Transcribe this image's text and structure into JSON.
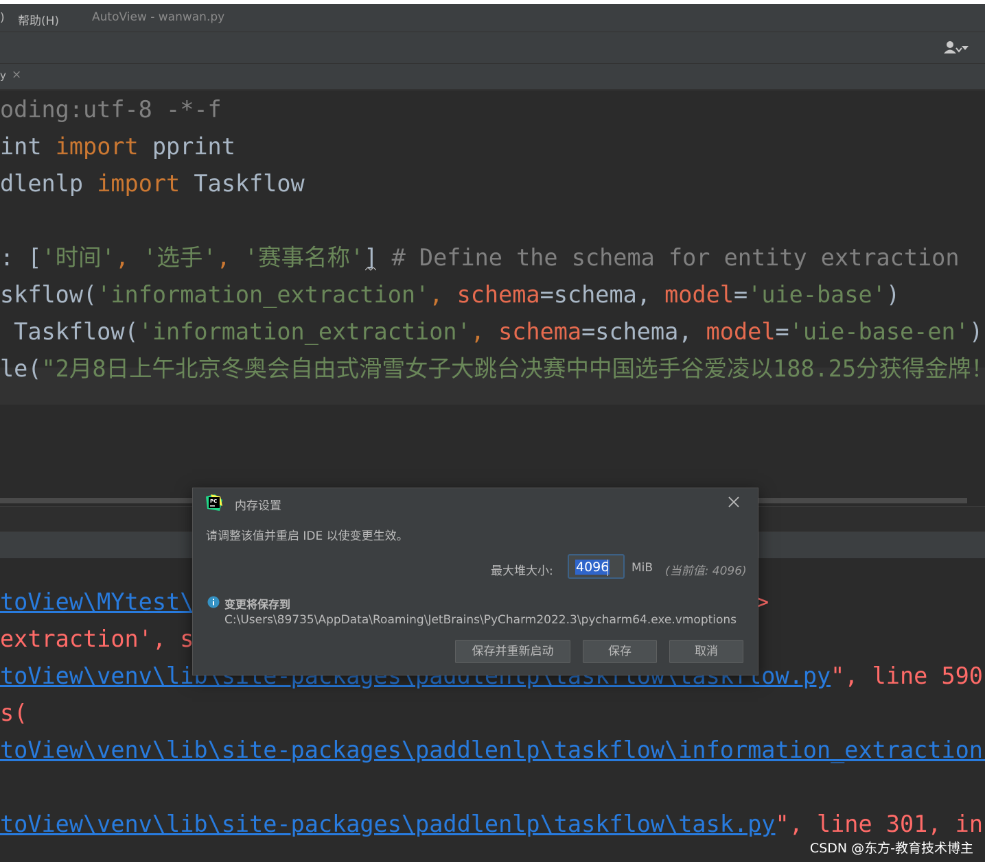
{
  "menubar": {
    "menu_fragment": ")",
    "help_menu": "帮助(H)",
    "window_title": "AutoView - wanwan.py"
  },
  "tab": {
    "label": "y",
    "close": "×"
  },
  "editor": {
    "lines": [
      {
        "text": "oding:utf-8 -*-f"
      },
      {
        "a": "int ",
        "kw": "import",
        "b": " pprint"
      },
      {
        "a": "dlenlp ",
        "kw": "import",
        "b": " Taskflow"
      },
      {
        "c": ": [",
        "s1": "'时间'",
        "c2": ", ",
        "s2": "'选手'",
        "c3": ", ",
        "s3": "'赛事名称'",
        "c4": "] ",
        "cm": "# Define the schema for entity extraction"
      },
      {
        "a": "skflow(",
        "s": "'information_extraction'",
        "b": ", ",
        "p1": "schema",
        "c": "=schema, ",
        "p2": "model",
        "d": "=",
        "s2": "'uie-base'",
        "e": ")"
      },
      {
        "a": " Taskflow(",
        "s": "'information_extraction'",
        "b": ", ",
        "p1": "schema",
        "c": "=schema, ",
        "p2": "model",
        "d": "=",
        "s2": "'uie-base-en'",
        "e": ")"
      },
      {
        "a": "le(",
        "s": "\"2月8日上午北京冬奥会自由式滑雪女子大跳台决赛中中国选手谷爱凌以188.25分获得金牌！\""
      }
    ]
  },
  "console": {
    "lines": [
      {
        "link": "toView\\MYtest\\",
        "err": ">"
      },
      {
        "err": "extraction', s"
      },
      {
        "link": "toView\\venv\\lib\\site-packages\\paddlenlp\\taskflow\\taskflow.py",
        "err": "\", line 590,"
      },
      {
        "err": "s("
      },
      {
        "link": "toView\\venv\\lib\\site-packages\\paddlenlp\\taskflow\\information_extraction.",
        "err": ""
      },
      {
        "link": "toView\\venv\\lib\\site-packages\\paddlenlp\\taskflow\\task.py",
        "err": "\", line 301, in"
      }
    ]
  },
  "watermark": "CSDN @东方-教育技术博主",
  "dialog": {
    "title": "内存设置",
    "description": "请调整该值并重启 IDE 以使变更生效。",
    "heap_label": "最大堆大小:",
    "heap_value": "4096",
    "heap_unit": "MiB",
    "current_value": "(当前值: 4096)",
    "save_to_title": "变更将保存到",
    "save_path": "C:\\Users\\89735\\AppData\\Roaming\\JetBrains\\PyCharm2022.3\\pycharm64.exe.vmoptions",
    "buttons": {
      "save_restart": "保存并重新启动",
      "save": "保存",
      "cancel": "取消"
    }
  },
  "colors": {
    "editor_bg": "#2b2b2b",
    "keyword": "#cc7832",
    "string": "#6a8759",
    "comment": "#808080",
    "param": "#e66b4f",
    "link": "#287bde",
    "error": "#ff6b68"
  },
  "icons": [
    "user-menu-icon",
    "pycharm-logo-icon",
    "close-icon",
    "info-icon",
    "tab-close-icon"
  ]
}
